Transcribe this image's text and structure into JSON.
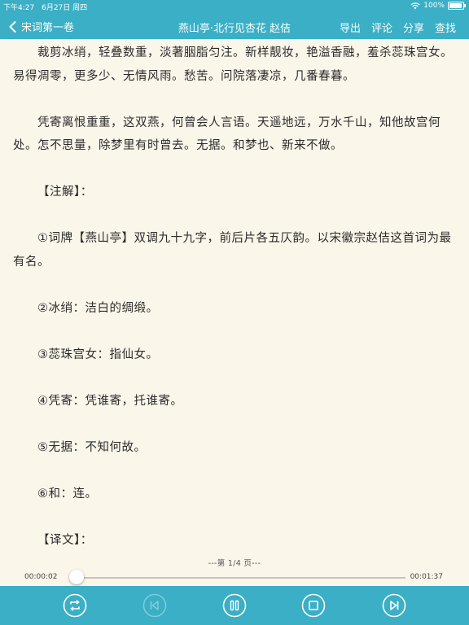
{
  "status_bar": {
    "time": "下午4:27",
    "date": "6月27日 周四",
    "battery": "100%"
  },
  "nav": {
    "back_label": "宋词第一卷",
    "title": "燕山亭·北行见杏花 赵佶",
    "actions": [
      "导出",
      "评论",
      "分享",
      "查找"
    ]
  },
  "content": {
    "paragraphs": [
      "裁剪冰绡，轻叠数重，淡著胭脂匀注。新样靓妆，艳溢香融，羞杀蕊珠宫女。易得凋零，更多少、无情风雨。愁苦。问院落凄凉，几番春暮。",
      "凭寄离恨重重，这双燕，何曾会人言语。天遥地远，万水千山，知他故宫何处。怎不思量，除梦里有时曾去。无据。和梦也、新来不做。",
      "【注解】：",
      "①词牌【燕山亭】双调九十九字，前后片各五仄韵。以宋徽宗赵佶这首词为最有名。",
      "②冰绡：洁白的绸缎。",
      "③蕊珠宫女：指仙女。",
      "④凭寄：凭谁寄，托谁寄。",
      "⑤无据：不知何故。",
      "⑥和：连。",
      "【译文】："
    ]
  },
  "player": {
    "page_indicator": "---第 1/4 页---",
    "elapsed": "00:00:02",
    "total": "00:01:37",
    "progress_fraction": 0.02
  },
  "icons": [
    "back-chevron-icon",
    "loop-icon",
    "skip-back-icon",
    "pause-icon",
    "stop-icon",
    "skip-forward-icon"
  ],
  "colors": {
    "accent": "#3AAFC6",
    "background": "#FBF6EA",
    "text": "#2B2B2B"
  }
}
